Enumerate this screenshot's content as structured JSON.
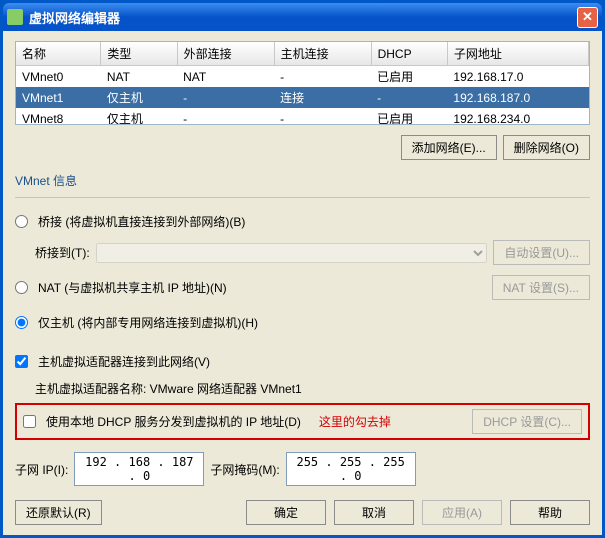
{
  "window": {
    "title": "虚拟网络编辑器"
  },
  "table": {
    "headers": [
      "名称",
      "类型",
      "外部连接",
      "主机连接",
      "DHCP",
      "子网地址"
    ],
    "rows": [
      {
        "cells": [
          "VMnet0",
          "NAT",
          "NAT",
          "-",
          "已启用",
          "192.168.17.0"
        ],
        "selected": false
      },
      {
        "cells": [
          "VMnet1",
          "仅主机",
          "-",
          "连接",
          "-",
          "192.168.187.0"
        ],
        "selected": true
      },
      {
        "cells": [
          "VMnet8",
          "仅主机",
          "-",
          "-",
          "已启用",
          "192.168.234.0"
        ],
        "selected": false
      }
    ]
  },
  "buttons": {
    "add_net": "添加网络(E)...",
    "remove_net": "删除网络(O)",
    "auto_set": "自动设置(U)...",
    "nat_set": "NAT 设置(S)...",
    "dhcp_set": "DHCP 设置(C)...",
    "restore": "还原默认(R)",
    "ok": "确定",
    "cancel": "取消",
    "apply": "应用(A)",
    "help": "帮助"
  },
  "info": {
    "group_title": "VMnet 信息",
    "radio_bridge": "桥接 (将虚拟机直接连接到外部网络)(B)",
    "bridge_to_label": "桥接到(T):",
    "radio_nat": "NAT (与虚拟机共享主机 IP 地址)(N)",
    "radio_host": "仅主机 (将内部专用网络连接到虚拟机)(H)",
    "check_hostadapter": "主机虚拟适配器连接到此网络(V)",
    "hostadapter_name_label": "主机虚拟适配器名称: VMware 网络适配器 VMnet1",
    "check_dhcp": "使用本地 DHCP 服务分发到虚拟机的 IP 地址(D)",
    "annotation": "这里的勾去掉",
    "subnet_ip_label": "子网 IP(I):",
    "subnet_ip": "192 . 168 . 187 . 0",
    "subnet_mask_label": "子网掩码(M):",
    "subnet_mask": "255 . 255 . 255 . 0"
  }
}
